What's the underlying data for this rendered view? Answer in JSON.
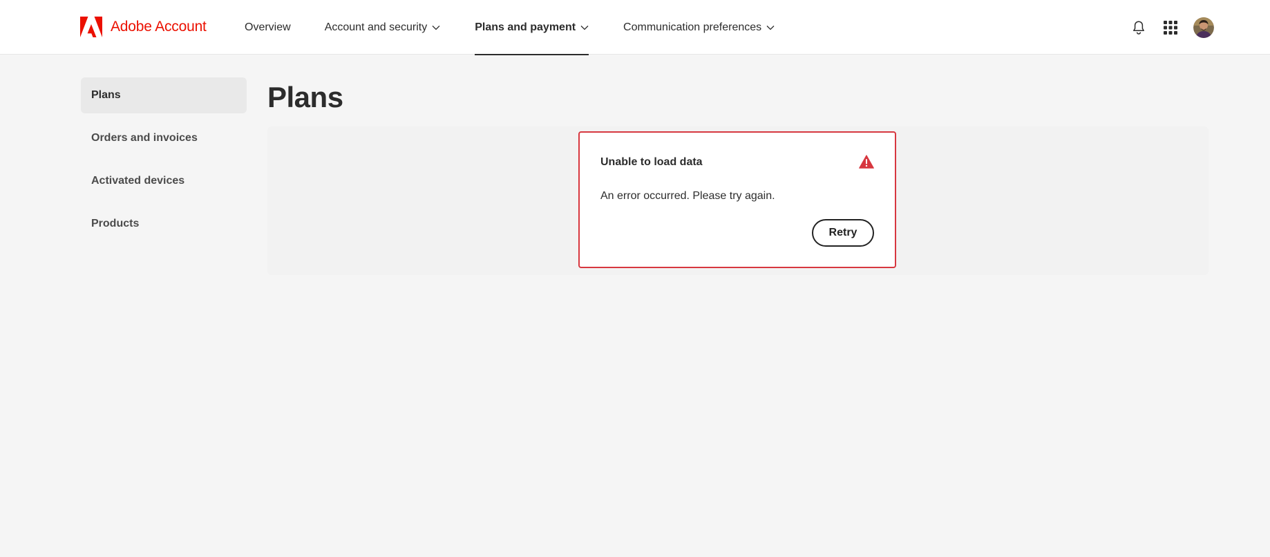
{
  "header": {
    "brand_name": "Adobe Account",
    "brand_color": "#eb1000",
    "logo_icon": "adobe-logo-icon",
    "nav": [
      {
        "label": "Overview",
        "has_dropdown": false,
        "active": false
      },
      {
        "label": "Account and security",
        "has_dropdown": true,
        "active": false
      },
      {
        "label": "Plans and payment",
        "has_dropdown": true,
        "active": true
      },
      {
        "label": "Communication preferences",
        "has_dropdown": true,
        "active": false
      }
    ],
    "actions": {
      "notifications_icon": "bell-icon",
      "apps_icon": "app-grid-icon",
      "avatar_icon": "user-avatar"
    }
  },
  "sidebar": {
    "items": [
      {
        "label": "Plans",
        "selected": true
      },
      {
        "label": "Orders and invoices",
        "selected": false
      },
      {
        "label": "Activated devices",
        "selected": false
      },
      {
        "label": "Products",
        "selected": false
      }
    ]
  },
  "main": {
    "title": "Plans",
    "error": {
      "title": "Unable to load data",
      "message": "An error occurred. Please try again.",
      "icon": "alert-triangle-icon",
      "border_color": "#d7373f",
      "retry_label": "Retry"
    }
  }
}
